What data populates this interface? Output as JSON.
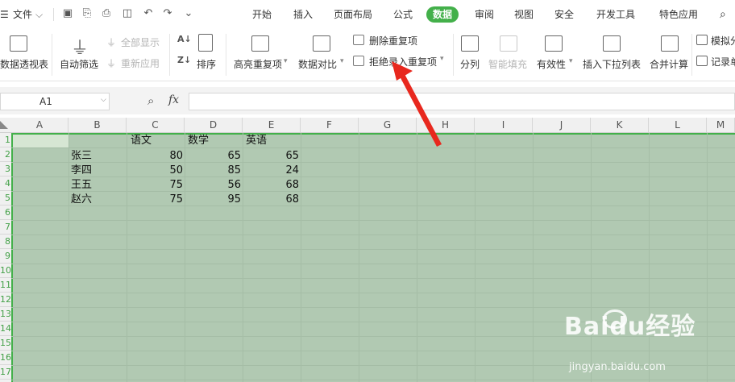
{
  "menubar": {
    "file_label": "文件",
    "tabs": [
      "开始",
      "插入",
      "页面布局",
      "公式",
      "数据",
      "审阅",
      "视图",
      "安全",
      "开发工具",
      "特色应用"
    ],
    "active_tab": "数据"
  },
  "ribbon": {
    "pivot": "数据透视表",
    "auto_filter": "自动筛选",
    "show_all": "全部显示",
    "reapply": "重新应用",
    "sort": "排序",
    "highlight_dup": "高亮重复项",
    "data_compare": "数据对比",
    "remove_dup": "删除重复项",
    "reject_dup": "拒绝录入重复项",
    "split_col": "分列",
    "smart_fill": "智能填充",
    "validity": "有效性",
    "insert_dropdown": "插入下拉列表",
    "merge_calc": "合并计算",
    "simulate": "模拟分",
    "record": "记录单"
  },
  "formula_bar": {
    "name_box": "A1",
    "fx": "fx",
    "value": ""
  },
  "grid": {
    "columns": [
      "A",
      "B",
      "C",
      "D",
      "E",
      "F",
      "G",
      "H",
      "I",
      "J",
      "K",
      "L",
      "M"
    ],
    "rows": [
      "1",
      "2",
      "3",
      "4",
      "5",
      "6",
      "7",
      "8",
      "9",
      "10",
      "11",
      "12",
      "13",
      "14",
      "15",
      "16",
      "17"
    ],
    "headers": [
      "语文",
      "数学",
      "英语"
    ],
    "records": [
      {
        "name": "张三",
        "chinese": "80",
        "math": "65",
        "english": "65"
      },
      {
        "name": "李四",
        "chinese": "50",
        "math": "85",
        "english": "24"
      },
      {
        "name": "王五",
        "chinese": "75",
        "math": "56",
        "english": "68"
      },
      {
        "name": "赵六",
        "chinese": "75",
        "math": "95",
        "english": "68"
      }
    ]
  },
  "watermark": {
    "brand": "Baidu经验",
    "url": "jingyan.baidu.com"
  },
  "colors": {
    "accent": "#43b04a",
    "selection": "#b1c9b2",
    "arrow": "#e8281e"
  }
}
